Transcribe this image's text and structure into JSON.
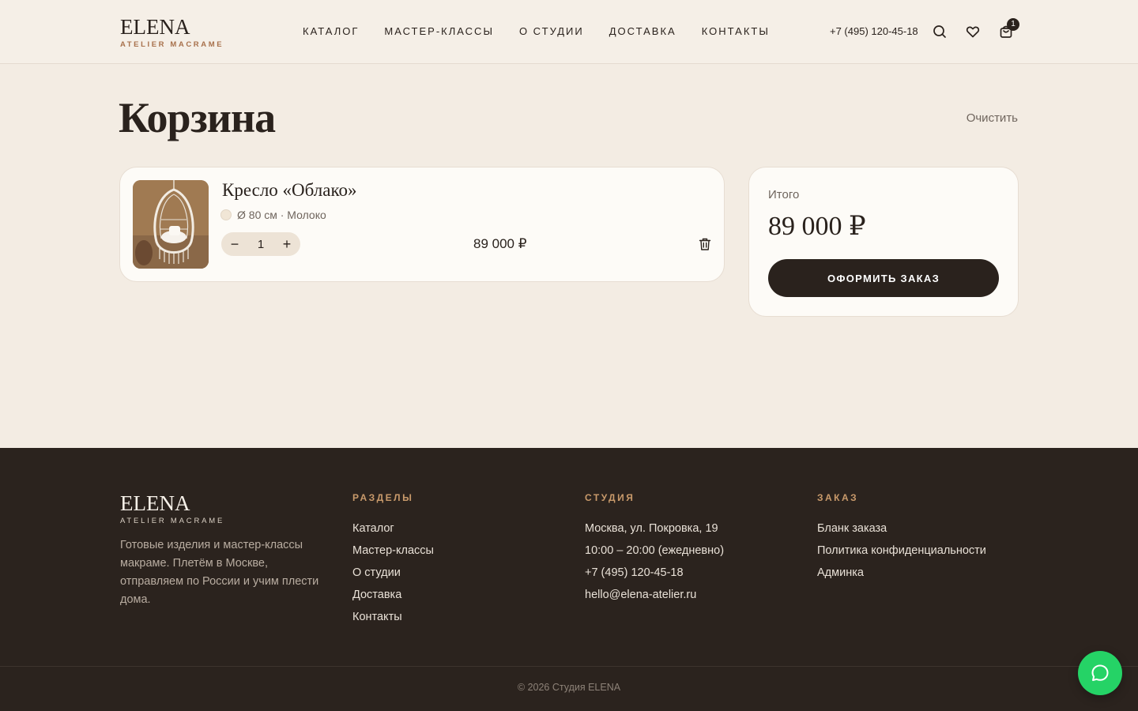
{
  "header": {
    "logo_title": "ELENA",
    "logo_sub": "ATELIER MACRAME",
    "nav": [
      "КАТАЛОГ",
      "МАСТЕР-КЛАССЫ",
      "О СТУДИИ",
      "ДОСТАВКА",
      "КОНТАКТЫ"
    ],
    "phone": "+7 (495) 120-45-18",
    "icons": [
      "search-icon",
      "heart-icon",
      "bag-icon"
    ],
    "cart_count": "1"
  },
  "page": {
    "title": "Корзина",
    "clear_label": "Очистить"
  },
  "cart_item": {
    "name": "Кресло «Облако»",
    "variant": "Ø 80 см · Молоко",
    "swatch_color": "#f1e6d6",
    "quantity": "1",
    "minus_symbol": "−",
    "plus_symbol": "+",
    "price": "89 000 ₽"
  },
  "summary": {
    "label": "Итого",
    "total": "89 000 ₽",
    "checkout_label": "ОФОРМИТЬ ЗАКАЗ"
  },
  "footer": {
    "logo_title": "ELENA",
    "logo_sub": "ATELIER MACRAME",
    "about": "Готовые изделия и мастер-классы макраме. Плетём в Москве, отправляем по России и учим плести дома.",
    "sections_title": "РАЗДЕЛЫ",
    "sections": [
      "Каталог",
      "Мастер-классы",
      "О студии",
      "Доставка",
      "Контакты"
    ],
    "studio_title": "СТУДИЯ",
    "studio": [
      "Москва, ул. Покровка, 19",
      "10:00 – 20:00 (ежедневно)",
      "+7 (495) 120-45-18",
      "hello@elena-atelier.ru"
    ],
    "order_title": "ЗАКАЗ",
    "order": [
      "Бланк заказа",
      "Политика конфиденциальности",
      "Админка"
    ],
    "copyright": "© 2026 Студия ELENA"
  },
  "colors": {
    "background": "#f3ece3",
    "dark": "#2a221d",
    "accent": "#a8714c",
    "chat": "#25d366"
  }
}
